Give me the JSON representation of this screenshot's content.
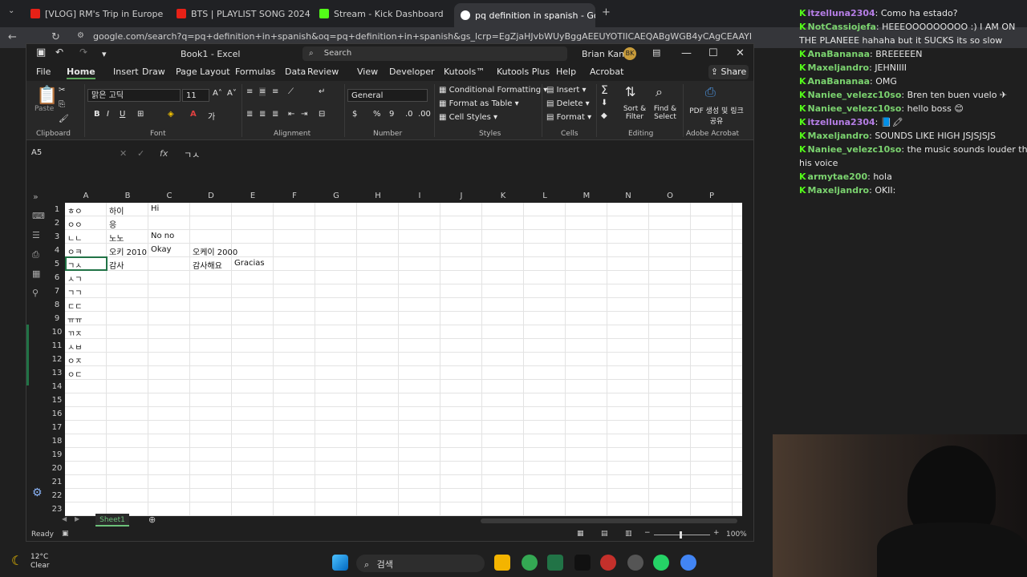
{
  "browser": {
    "tabs": [
      {
        "label": "[VLOG] RM's Trip in Europe - Y"
      },
      {
        "label": "BTS | PLAYLIST SONG 2024"
      },
      {
        "label": "Stream - Kick Dashboard"
      },
      {
        "label": "pq definition in spanish - Goo"
      }
    ],
    "url": "google.com/search?q=pq+definition+in+spanish&oq=pq+definition+in+spanish&gs_lcrp=EgZjaHJvbWUyBggAEEUYOTIICAEQABgWGB4yCAgCEAAYFhgeMggIAxAAGBYYHhINCAQQABiGAxiABBiKBTI"
  },
  "excel": {
    "title": "Book1 - Excel",
    "search_placeholder": "Search",
    "user": "Brian Kang",
    "user_initials": "BK",
    "menu": [
      "File",
      "Home",
      "Insert",
      "Draw",
      "Page Layout",
      "Formulas",
      "Data",
      "Review",
      "View",
      "Developer",
      "Kutools™",
      "Kutools Plus",
      "Help",
      "Acrobat"
    ],
    "share_label": "Share",
    "ribbon": {
      "font_name": "맑은 고딕",
      "font_size": "11",
      "number_format": "General",
      "conditional_formatting": "Conditional Formatting",
      "format_as_table": "Format as Table",
      "cell_styles": "Cell Styles",
      "insert": "Insert",
      "delete": "Delete",
      "format": "Format",
      "sort_filter": "Sort & Filter",
      "find_select": "Find & Select",
      "pdf_share": "PDF 생성 및 링크 공유",
      "groups": [
        "Clipboard",
        "Font",
        "Alignment",
        "Number",
        "Styles",
        "Cells",
        "Editing",
        "Adobe Acrobat"
      ],
      "paste": "Paste"
    },
    "name_box": "A5",
    "formula_value": "ㄱㅅ",
    "columns": [
      "A",
      "B",
      "C",
      "D",
      "E",
      "F",
      "G",
      "H",
      "I",
      "J",
      "K",
      "L",
      "M",
      "N",
      "O",
      "P"
    ],
    "rows": [
      "1",
      "2",
      "3",
      "4",
      "5",
      "6",
      "7",
      "8",
      "9",
      "10",
      "11",
      "12",
      "13",
      "14",
      "15",
      "16",
      "17",
      "18",
      "19",
      "20",
      "21",
      "22",
      "23"
    ],
    "cells": {
      "A1": "ㅎㅇ",
      "B1": "하이",
      "C1": "Hi",
      "A2": "ㅇㅇ",
      "B2": "응",
      "A3": "ㄴㄴ",
      "B3": "노노",
      "C3": "No no",
      "A4": "ㅇㅋ",
      "B4": "오키 2010",
      "C4": "Okay",
      "D4": "오케이 2000",
      "A5": "ㄱㅅ",
      "B5": "감사",
      "D5": "감사해요",
      "E5": "Gracias",
      "A6": "ㅅㄱ",
      "A7": "ㄱㄱ",
      "A8": "ㄷㄷ",
      "A9": "ㅠㅠ",
      "A10": "ㄲㅈ",
      "A11": "ㅅㅂ",
      "A12": "ㅇㅈ",
      "A13": "ㅇㄷ"
    },
    "sheet_tab": "Sheet1",
    "status": "Ready",
    "zoom": "100%"
  },
  "chat": [
    {
      "user": "itzelluna2304",
      "msg": "Como ha estado?",
      "color": "purple"
    },
    {
      "user": "NotCassiojefa",
      "msg": "HEEEOOOOOOOOO :) I AM ON",
      "color": "green"
    },
    {
      "user": "",
      "msg": "THE PLANEEE hahaha but it SUCKS its so slow",
      "color": "green"
    },
    {
      "user": "AnaBananaa",
      "msg": "BREEEEEN",
      "color": "green"
    },
    {
      "user": "Maxeljandro",
      "msg": "JEHNIIII",
      "color": "green"
    },
    {
      "user": "AnaBananaa",
      "msg": "OMG",
      "color": "green"
    },
    {
      "user": "Naniee_velezc10so",
      "msg": "Bren ten buen vuelo ✈",
      "color": "green"
    },
    {
      "user": "Naniee_velezc10so",
      "msg": "hello boss 😊",
      "color": "green"
    },
    {
      "user": "itzelluna2304",
      "msg": "📘🖍",
      "color": "purple"
    },
    {
      "user": "Maxeljandro",
      "msg": "SOUNDS LIKE HIGH JSJSJSJS",
      "color": "green"
    },
    {
      "user": "Naniee_velezc10so",
      "msg": "the music sounds louder than",
      "color": "green"
    },
    {
      "user": "",
      "msg": "his voice",
      "color": "green"
    },
    {
      "user": "armytae200",
      "msg": "hola",
      "color": "green"
    },
    {
      "user": "Maxeljandro",
      "msg": "OKII:",
      "color": "green"
    }
  ],
  "taskbar": {
    "weather_temp": "12°C",
    "weather_desc": "Clear",
    "search_label": "검색"
  },
  "colors": {
    "excel_green": "#217346",
    "kick_green": "#53fc18"
  }
}
